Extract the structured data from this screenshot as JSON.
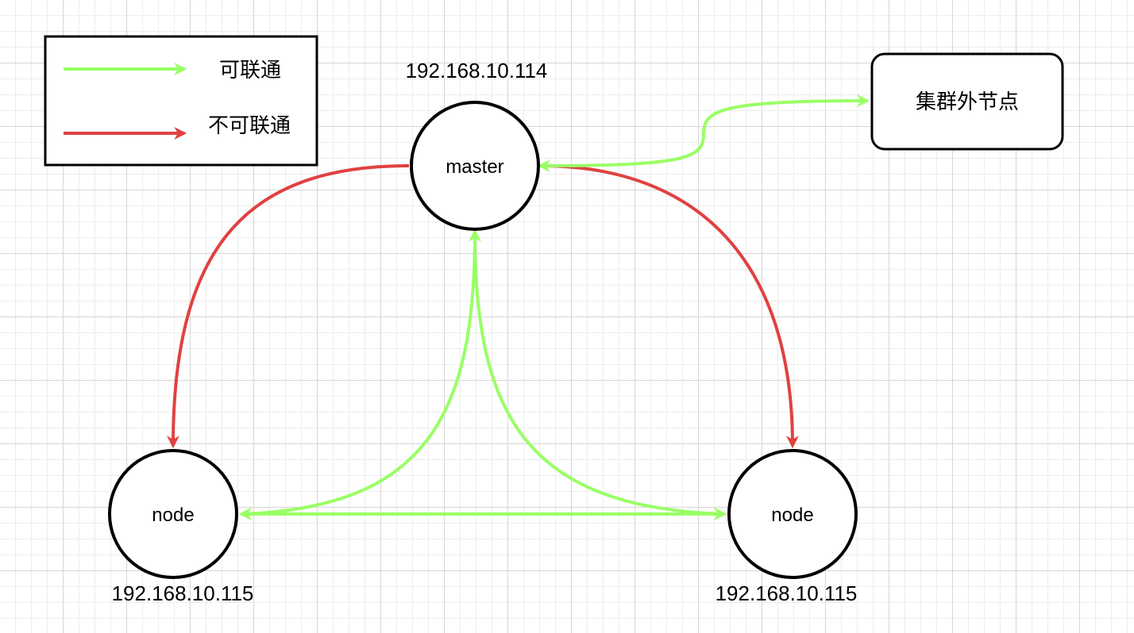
{
  "legend": {
    "connected": "可联通",
    "not_connected": "不可联通"
  },
  "nodes": {
    "master": {
      "label": "master",
      "ip": "192.168.10.114"
    },
    "node_left": {
      "label": "node",
      "ip": "192.168.10.115"
    },
    "node_right": {
      "label": "node",
      "ip": "192.168.10.115"
    },
    "external": {
      "label": "集群外节点"
    }
  },
  "colors": {
    "connected": "#99ff66",
    "not_connected": "#e04141",
    "stroke": "#000000"
  }
}
